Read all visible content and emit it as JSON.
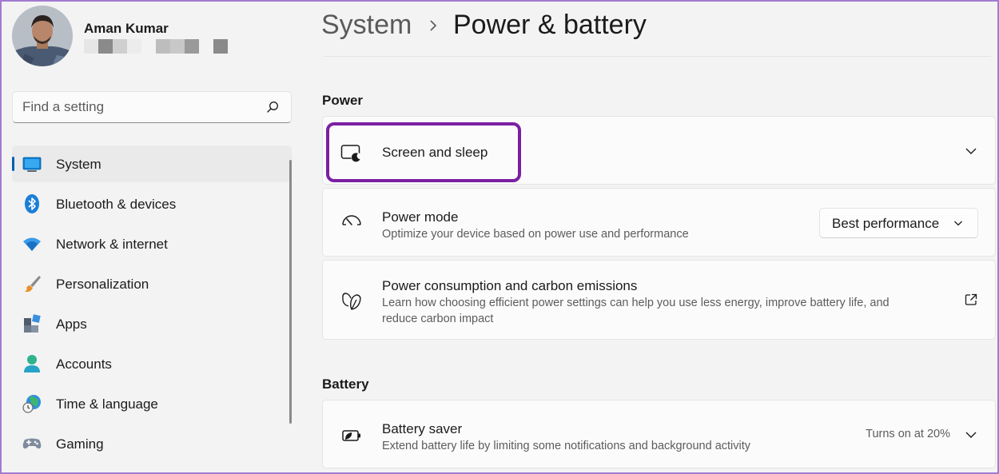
{
  "profile": {
    "name": "Aman Kumar"
  },
  "search": {
    "placeholder": "Find a setting",
    "icon": "search-icon"
  },
  "sidebar": {
    "items": [
      {
        "label": "System",
        "icon": "system-icon",
        "selected": true
      },
      {
        "label": "Bluetooth & devices",
        "icon": "bluetooth-icon"
      },
      {
        "label": "Network & internet",
        "icon": "wifi-icon"
      },
      {
        "label": "Personalization",
        "icon": "brush-icon"
      },
      {
        "label": "Apps",
        "icon": "apps-icon"
      },
      {
        "label": "Accounts",
        "icon": "accounts-icon"
      },
      {
        "label": "Time & language",
        "icon": "globe-clock-icon"
      },
      {
        "label": "Gaming",
        "icon": "gamepad-icon"
      }
    ]
  },
  "breadcrumb": {
    "parent": "System",
    "current": "Power & battery"
  },
  "power": {
    "section_title": "Power",
    "screen_sleep": {
      "title": "Screen and sleep",
      "icon": "screen-sleep-icon"
    },
    "power_mode": {
      "title": "Power mode",
      "description": "Optimize your device based on power use and performance",
      "value": "Best performance",
      "icon": "speedometer-icon"
    },
    "consumption": {
      "title": "Power consumption and carbon emissions",
      "description_line1": "Learn how choosing efficient power settings can help you use less energy, improve battery life, and",
      "description_line2": "reduce carbon impact",
      "icon": "leaf-icon"
    }
  },
  "battery": {
    "section_title": "Battery",
    "saver": {
      "title": "Battery saver",
      "description": "Extend battery life by limiting some notifications and background activity",
      "status": "Turns on at 20%",
      "icon": "battery-saver-icon"
    }
  },
  "colors": {
    "accent": "#005fb8",
    "highlight": "#7b1fa2"
  }
}
